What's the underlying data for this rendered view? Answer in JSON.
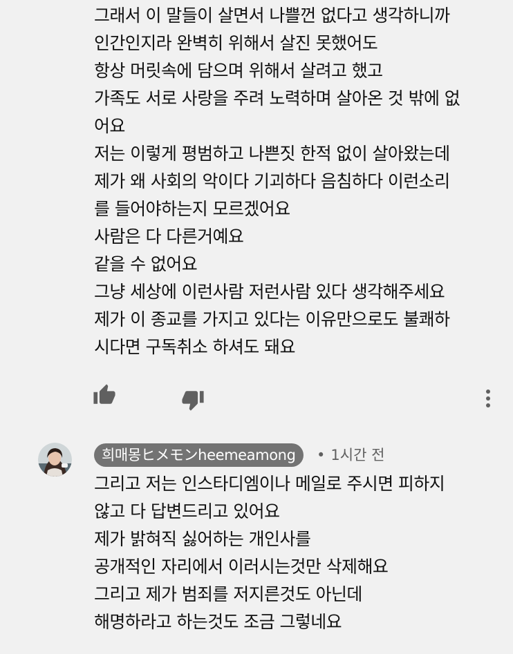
{
  "comment1": {
    "lines": [
      "그래서 이 말들이 살면서 나쁠껀 없다고 생각하니까",
      "인간인지라 완벽히 위해서 살진 못했어도",
      "항상 머릿속에 담으며 위해서 살려고 했고",
      "가족도 서로 사랑을 주려 노력하며 살아온 것 밖에 없",
      "어요",
      "저는 이렇게 평범하고 나쁜짓 한적 없이 살아왔는데",
      "제가 왜 사회의 악이다 기괴하다 음침하다 이런소리",
      "를 들어야하는지 모르겠어요",
      "사람은 다 다른거예요",
      "같을 수 없어요",
      "그냥 세상에 이런사람 저런사람 있다 생각해주세요",
      "제가 이 종교를 가지고 있다는 이유만으로도 불쾌하",
      "시다면 구독취소 하셔도 돼요"
    ],
    "actions": {
      "like_icon": "thumbs-up-icon",
      "dislike_icon": "thumbs-down-icon",
      "more_icon": "more-vertical-icon"
    }
  },
  "comment2": {
    "author": "희매몽ヒメモンheemeamong",
    "separator": "•",
    "timestamp": "1시간 전",
    "lines": [
      "그리고 저는 인스타디엠이나 메일로 주시면 피하지",
      "않고 다 답변드리고 있어요",
      "제가 밝혀직 싫어하는 개인사를",
      "공개적인 자리에서 이러시는것만 삭제해요",
      "그리고 제가 범죄를 저지른것도 아닌데",
      "해명하라고 하는것도 조금 그렇네요"
    ]
  },
  "colors": {
    "background": "#f1f1f1",
    "text": "#111111",
    "author_chip": "#737373",
    "icon": "#606060",
    "timestamp": "#606060"
  }
}
